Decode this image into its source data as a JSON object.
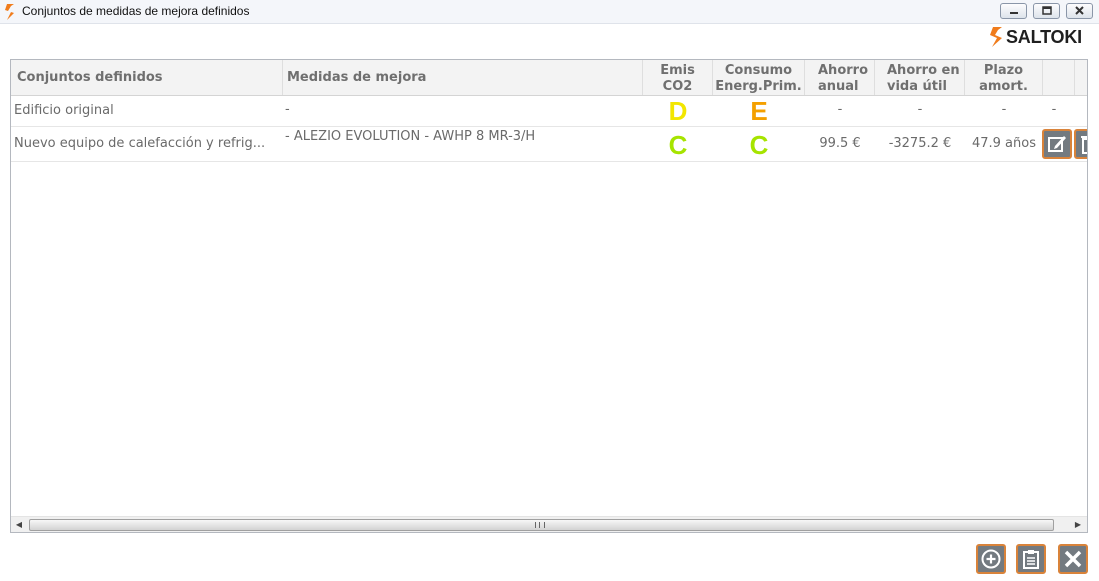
{
  "window": {
    "title": "Conjuntos de medidas de mejora definidos",
    "app_icon": "saltoki-s-icon",
    "controls": [
      "minimize-icon",
      "maximize-icon",
      "close-icon"
    ]
  },
  "logo": {
    "text": "SALTOKI",
    "accent_color": "#f07c1c"
  },
  "table": {
    "columns": [
      {
        "line1": "Conjuntos definidos",
        "line2": ""
      },
      {
        "line1": "Medidas de mejora",
        "line2": ""
      },
      {
        "line1": "Emis",
        "line2": "CO2"
      },
      {
        "line1": "Consumo",
        "line2": "Energ.Prim."
      },
      {
        "line1": "Ahorro",
        "line2": "anual"
      },
      {
        "line1": "Ahorro en",
        "line2": "vida útil"
      },
      {
        "line1": "Plazo",
        "line2": "amort."
      }
    ],
    "rows": [
      {
        "name": "Edificio original",
        "measures": "-",
        "emis_co2": "D",
        "emis_co2_color": "#f2e600",
        "consumo": "E",
        "consumo_color": "#f4a000",
        "ahorro_anual": "-",
        "ahorro_vida": "-",
        "plazo": "-",
        "actions": "-"
      },
      {
        "name": "Nuevo equipo de calefacción y refrig...",
        "measures": "- ALEZIO EVOLUTION - AWHP 8 MR-3/H",
        "emis_co2": "C",
        "emis_co2_color": "#a6e400",
        "consumo": "C",
        "consumo_color": "#a6e400",
        "ahorro_anual": "99.5 €",
        "ahorro_vida": "-3275.2 €",
        "plazo": "47.9 años",
        "actions": [
          "edit-icon",
          "delete-icon"
        ]
      }
    ]
  },
  "footer_buttons": [
    "add-circle-icon",
    "clipboard-icon",
    "close-x-icon"
  ],
  "colors": {
    "button_border": "#d9833a",
    "button_fill": "#737a80"
  }
}
